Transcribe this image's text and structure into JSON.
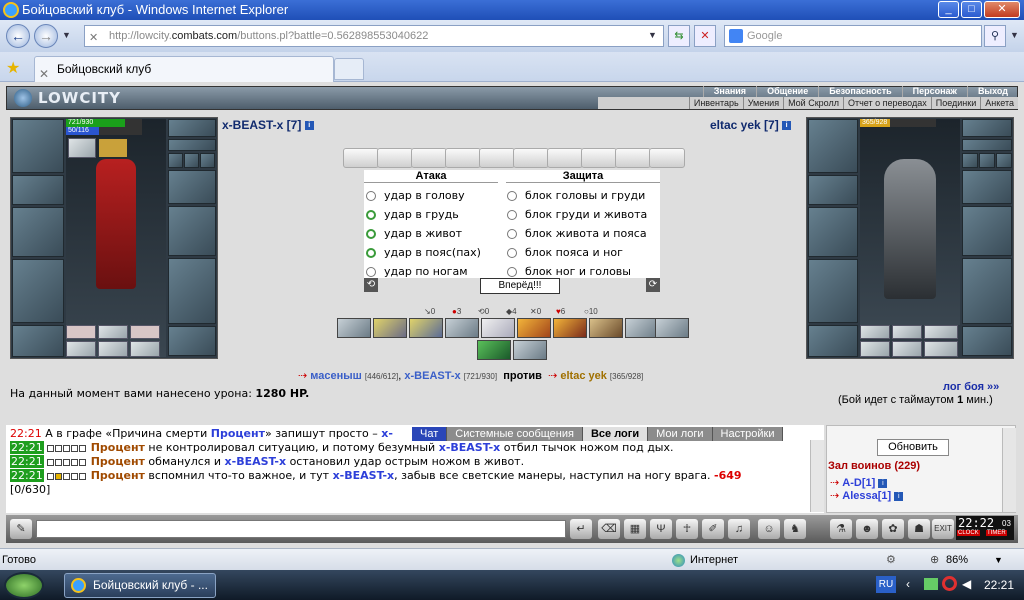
{
  "window": {
    "title": "Бойцовский клуб - Windows Internet Explorer",
    "tab_title": "Бойцовский клуб",
    "taskbar_title": "Бойцовский клуб - ..."
  },
  "address": {
    "prefix": "http://lowcity.",
    "domain": "combats.com",
    "suffix": "/buttons.pl?battle=0.562898553040622"
  },
  "search": {
    "placeholder": "Google"
  },
  "game": {
    "logo": "LOWCITY",
    "topmenu": [
      "Знания",
      "Общение",
      "Безопасность",
      "Персонаж",
      "Выход"
    ],
    "submenu": [
      "Инвентарь",
      "Умения",
      "Мой Скролл",
      "Отчет о переводах",
      "Поединки",
      "Анкета"
    ]
  },
  "player1": {
    "name": "x-BEAST-x [7]",
    "hp": "721/930",
    "hp_fraction": 0.775,
    "mana": "50/116",
    "mana_fraction": 0.43
  },
  "player2": {
    "name": "eltac yek [7]",
    "hp": "365/928",
    "hp_fraction": 0.393
  },
  "attack": {
    "header": "Атака",
    "options": [
      "удар в голову",
      "удар в грудь",
      "удар в живот",
      "удар в пояс(пах)",
      "удар по ногам"
    ],
    "selected": [
      1,
      2,
      3
    ]
  },
  "defense": {
    "header": "Защита",
    "options": [
      "блок головы и груди",
      "блок груди и живота",
      "блок живота и пояса",
      "блок пояса и ног",
      "блок ног и головы"
    ]
  },
  "forward_button": "Вперёд!!!",
  "counters": [
    "0",
    "3",
    "0",
    "4",
    "0",
    "6",
    "10"
  ],
  "versus": {
    "team1_a": "масеныш",
    "team1_a_hp": "[446/612]",
    "team1_b": "x-BEAST-x",
    "team1_b_hp": "[721/930]",
    "vs": "против",
    "team2": "eltac yek",
    "team2_hp": "[365/928]"
  },
  "damage": {
    "label": "На данный момент вами нанесено урона:",
    "value": "1280 HP."
  },
  "battle_log_link": "лог боя »»",
  "timeout": {
    "prefix": "(Бой идет с таймаутом",
    "value": "1",
    "suffix": "мин.)"
  },
  "log_tabs": [
    "Чат",
    "Системные сообщения",
    "Все логи",
    "Мои логи",
    "Настройки"
  ],
  "log": [
    {
      "time": "22:21",
      "time_color": "red",
      "text": "А в графе «Причина смерти ",
      "name1": "Процент",
      "text2": "» запишут просто – ",
      "name2": "x-"
    },
    {
      "time": "22:21",
      "name1": "Процент",
      "text": " не контролировал ситуацию, и потому безумный ",
      "name2": "x-BEAST-x",
      "text2": " отбил тычок ножом под дых."
    },
    {
      "time": "22:21",
      "name1": "Процент",
      "text": " обманулся и ",
      "name2": "x-BEAST-x",
      "text2": " остановил удар острым ножом в живот."
    },
    {
      "time": "22:21",
      "name1": "Процент",
      "text": " вспомнил что-то важное, и тут ",
      "name2": "x-BEAST-x",
      "text2": ", забыв все светские манеры, наступил на ногу врага. ",
      "damage": "-649",
      "extra": "[0/630]"
    }
  ],
  "sidepanel": {
    "refresh_button": "Обновить",
    "hall_title": "Зал воинов (229)",
    "users": [
      "A-D[1]",
      "Alessa[1]"
    ]
  },
  "clock": {
    "time": "22:22",
    "seconds": "03",
    "labels": [
      "CLOCK",
      "TIMER"
    ]
  },
  "status": {
    "left": "Готово",
    "zone": "Интернет",
    "zoom": "86%"
  },
  "tray": {
    "lang": "RU",
    "time": "22:21"
  }
}
